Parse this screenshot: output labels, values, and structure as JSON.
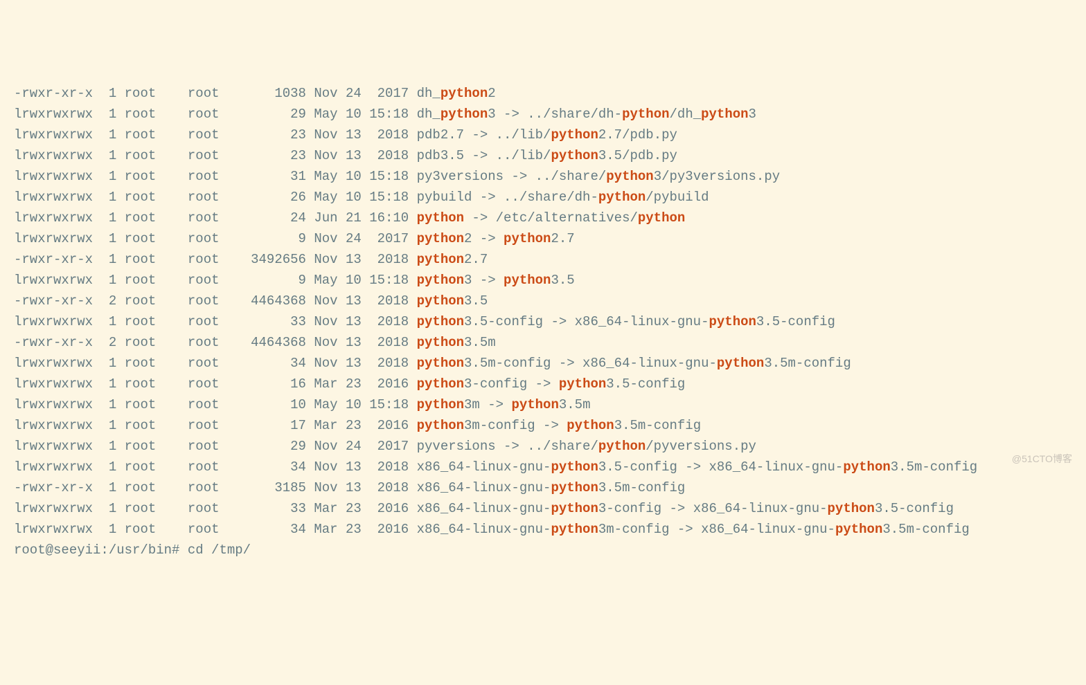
{
  "rows": [
    {
      "perm": "-rwxr-xr-x",
      "n": "1",
      "u": "root",
      "g": "root",
      "sz": "1038",
      "mon": "Nov",
      "day": "24",
      "tm": " 2017",
      "segs": [
        "dh_",
        {
          "h": "python"
        },
        "2"
      ]
    },
    {
      "perm": "lrwxrwxrwx",
      "n": "1",
      "u": "root",
      "g": "root",
      "sz": "29",
      "mon": "May",
      "day": "10",
      "tm": "15:18",
      "segs": [
        "dh_",
        {
          "h": "python"
        },
        "3 -> ../share/dh-",
        {
          "h": "python"
        },
        "/dh_",
        {
          "h": "python"
        },
        "3"
      ]
    },
    {
      "perm": "lrwxrwxrwx",
      "n": "1",
      "u": "root",
      "g": "root",
      "sz": "23",
      "mon": "Nov",
      "day": "13",
      "tm": " 2018",
      "segs": [
        "pdb2.7 -> ../lib/",
        {
          "h": "python"
        },
        "2.7/pdb.py"
      ]
    },
    {
      "perm": "lrwxrwxrwx",
      "n": "1",
      "u": "root",
      "g": "root",
      "sz": "23",
      "mon": "Nov",
      "day": "13",
      "tm": " 2018",
      "segs": [
        "pdb3.5 -> ../lib/",
        {
          "h": "python"
        },
        "3.5/pdb.py"
      ]
    },
    {
      "perm": "lrwxrwxrwx",
      "n": "1",
      "u": "root",
      "g": "root",
      "sz": "31",
      "mon": "May",
      "day": "10",
      "tm": "15:18",
      "segs": [
        "py3versions -> ../share/",
        {
          "h": "python"
        },
        "3/py3versions.py"
      ]
    },
    {
      "perm": "lrwxrwxrwx",
      "n": "1",
      "u": "root",
      "g": "root",
      "sz": "26",
      "mon": "May",
      "day": "10",
      "tm": "15:18",
      "segs": [
        "pybuild -> ../share/dh-",
        {
          "h": "python"
        },
        "/pybuild"
      ]
    },
    {
      "perm": "lrwxrwxrwx",
      "n": "1",
      "u": "root",
      "g": "root",
      "sz": "24",
      "mon": "Jun",
      "day": "21",
      "tm": "16:10",
      "segs": [
        {
          "h": "python"
        },
        " -> /etc/alternatives/",
        {
          "h": "python"
        }
      ]
    },
    {
      "perm": "lrwxrwxrwx",
      "n": "1",
      "u": "root",
      "g": "root",
      "sz": "9",
      "mon": "Nov",
      "day": "24",
      "tm": " 2017",
      "segs": [
        {
          "h": "python"
        },
        "2 -> ",
        {
          "h": "python"
        },
        "2.7"
      ]
    },
    {
      "perm": "-rwxr-xr-x",
      "n": "1",
      "u": "root",
      "g": "root",
      "sz": "3492656",
      "mon": "Nov",
      "day": "13",
      "tm": " 2018",
      "segs": [
        {
          "h": "python"
        },
        "2.7"
      ]
    },
    {
      "perm": "lrwxrwxrwx",
      "n": "1",
      "u": "root",
      "g": "root",
      "sz": "9",
      "mon": "May",
      "day": "10",
      "tm": "15:18",
      "segs": [
        {
          "h": "python"
        },
        "3 -> ",
        {
          "h": "python"
        },
        "3.5"
      ]
    },
    {
      "perm": "-rwxr-xr-x",
      "n": "2",
      "u": "root",
      "g": "root",
      "sz": "4464368",
      "mon": "Nov",
      "day": "13",
      "tm": " 2018",
      "segs": [
        {
          "h": "python"
        },
        "3.5"
      ]
    },
    {
      "perm": "lrwxrwxrwx",
      "n": "1",
      "u": "root",
      "g": "root",
      "sz": "33",
      "mon": "Nov",
      "day": "13",
      "tm": " 2018",
      "segs": [
        {
          "h": "python"
        },
        "3.5-config -> x86_64-linux-gnu-",
        {
          "h": "python"
        },
        "3.5-config"
      ]
    },
    {
      "perm": "-rwxr-xr-x",
      "n": "2",
      "u": "root",
      "g": "root",
      "sz": "4464368",
      "mon": "Nov",
      "day": "13",
      "tm": " 2018",
      "segs": [
        {
          "h": "python"
        },
        "3.5m"
      ]
    },
    {
      "perm": "lrwxrwxrwx",
      "n": "1",
      "u": "root",
      "g": "root",
      "sz": "34",
      "mon": "Nov",
      "day": "13",
      "tm": " 2018",
      "segs": [
        {
          "h": "python"
        },
        "3.5m-config -> x86_64-linux-gnu-",
        {
          "h": "python"
        },
        "3.5m-config"
      ]
    },
    {
      "perm": "lrwxrwxrwx",
      "n": "1",
      "u": "root",
      "g": "root",
      "sz": "16",
      "mon": "Mar",
      "day": "23",
      "tm": " 2016",
      "segs": [
        {
          "h": "python"
        },
        "3-config -> ",
        {
          "h": "python"
        },
        "3.5-config"
      ]
    },
    {
      "perm": "lrwxrwxrwx",
      "n": "1",
      "u": "root",
      "g": "root",
      "sz": "10",
      "mon": "May",
      "day": "10",
      "tm": "15:18",
      "segs": [
        {
          "h": "python"
        },
        "3m -> ",
        {
          "h": "python"
        },
        "3.5m"
      ]
    },
    {
      "perm": "lrwxrwxrwx",
      "n": "1",
      "u": "root",
      "g": "root",
      "sz": "17",
      "mon": "Mar",
      "day": "23",
      "tm": " 2016",
      "segs": [
        {
          "h": "python"
        },
        "3m-config -> ",
        {
          "h": "python"
        },
        "3.5m-config"
      ]
    },
    {
      "perm": "lrwxrwxrwx",
      "n": "1",
      "u": "root",
      "g": "root",
      "sz": "29",
      "mon": "Nov",
      "day": "24",
      "tm": " 2017",
      "segs": [
        "pyversions -> ../share/",
        {
          "h": "python"
        },
        "/pyversions.py"
      ]
    },
    {
      "perm": "lrwxrwxrwx",
      "n": "1",
      "u": "root",
      "g": "root",
      "sz": "34",
      "mon": "Nov",
      "day": "13",
      "tm": " 2018",
      "segs": [
        "x86_64-linux-gnu-",
        {
          "h": "python"
        },
        "3.5-config -> x86_64-linux-gnu-",
        {
          "h": "python"
        },
        "3.5m-config"
      ]
    },
    {
      "perm": "-rwxr-xr-x",
      "n": "1",
      "u": "root",
      "g": "root",
      "sz": "3185",
      "mon": "Nov",
      "day": "13",
      "tm": " 2018",
      "segs": [
        "x86_64-linux-gnu-",
        {
          "h": "python"
        },
        "3.5m-config"
      ]
    },
    {
      "perm": "lrwxrwxrwx",
      "n": "1",
      "u": "root",
      "g": "root",
      "sz": "33",
      "mon": "Mar",
      "day": "23",
      "tm": " 2016",
      "segs": [
        "x86_64-linux-gnu-",
        {
          "h": "python"
        },
        "3-config -> x86_64-linux-gnu-",
        {
          "h": "python"
        },
        "3.5-config"
      ]
    },
    {
      "perm": "lrwxrwxrwx",
      "n": "1",
      "u": "root",
      "g": "root",
      "sz": "34",
      "mon": "Mar",
      "day": "23",
      "tm": " 2016",
      "segs": [
        "x86_64-linux-gnu-",
        {
          "h": "python"
        },
        "3m-config -> x86_64-linux-gnu-",
        {
          "h": "python"
        },
        "3.5m-config"
      ]
    }
  ],
  "prompt1": "root@seeyii:/usr/bin# cd /tmp/",
  "watermark": "@51CTO博客"
}
